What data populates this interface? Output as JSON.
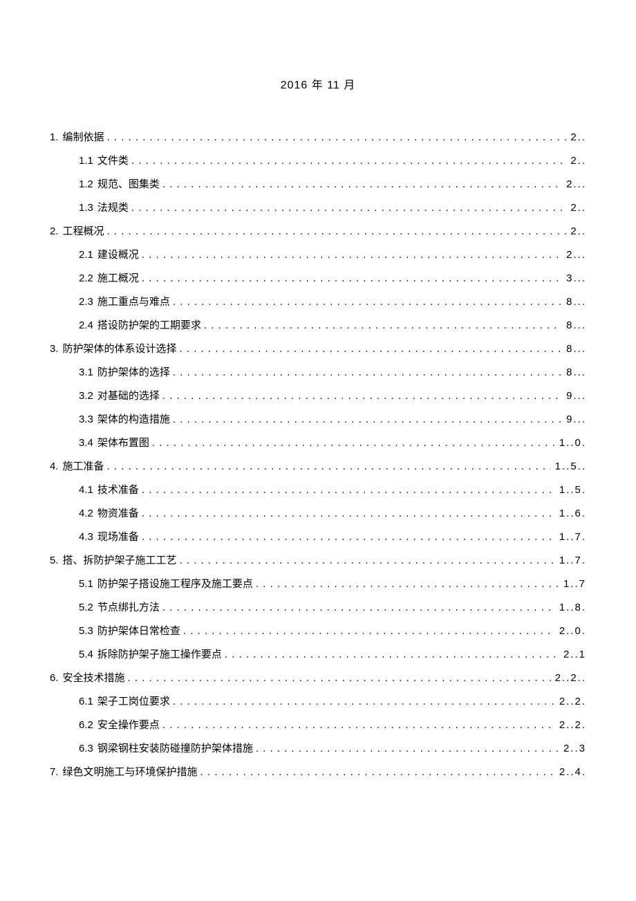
{
  "date": "2016 年 11 月",
  "toc": [
    {
      "level": 1,
      "num": "1.",
      "title": "编制依据",
      "page": "2.."
    },
    {
      "level": 2,
      "num": "1.1",
      "title": "文件类",
      "page": "2.."
    },
    {
      "level": 2,
      "num": "1.2",
      "title": "规范、图集类",
      "page": "2..."
    },
    {
      "level": 2,
      "num": "1.3",
      "title": "法规类",
      "page": "2.."
    },
    {
      "level": 1,
      "num": "2.",
      "title": "工程概况",
      "page": "2.."
    },
    {
      "level": 2,
      "num": "2.1",
      "title": "建设概况",
      "page": "2..."
    },
    {
      "level": 2,
      "num": "2.2",
      "title": "施工概况",
      "page": "3..."
    },
    {
      "level": 2,
      "num": "2.3",
      "title": "施工重点与难点",
      "page": "8..."
    },
    {
      "level": 2,
      "num": "2.4",
      "title": "搭设防护架的工期要求",
      "page": "8..."
    },
    {
      "level": 1,
      "num": "3.",
      "title": "防护架体的体系设计选择",
      "page": "8..."
    },
    {
      "level": 2,
      "num": "3.1",
      "title": "防护架体的选择",
      "page": "8..."
    },
    {
      "level": 2,
      "num": "3.2",
      "title": "对基础的选择",
      "page": "9..."
    },
    {
      "level": 2,
      "num": "3.3",
      "title": "架体的构造措施",
      "page": "9..."
    },
    {
      "level": 2,
      "num": "3.4",
      "title": "架体布置图",
      "page": "1..0."
    },
    {
      "level": 1,
      "num": "4.",
      "title": "施工准备",
      "page": "1..5.."
    },
    {
      "level": 2,
      "num": "4.1",
      "title": "技术准备",
      "page": "1..5."
    },
    {
      "level": 2,
      "num": "4.2",
      "title": "物资准备",
      "page": "1..6."
    },
    {
      "level": 2,
      "num": "4.3",
      "title": "现场准备",
      "page": "1..7."
    },
    {
      "level": 1,
      "num": "5.",
      "title": "搭、拆防护架子施工工艺",
      "page": "1..7."
    },
    {
      "level": 2,
      "num": "5.1",
      "title": "防护架子搭设施工程序及施工要点",
      "page": "1..7"
    },
    {
      "level": 2,
      "num": "5.2",
      "title": "节点绑扎方法",
      "page": "1..8."
    },
    {
      "level": 2,
      "num": "5.3",
      "title": "防护架体日常检查",
      "page": "2..0."
    },
    {
      "level": 2,
      "num": "5.4",
      "title": "拆除防护架子施工操作要点",
      "page": "2..1"
    },
    {
      "level": 1,
      "num": "6.",
      "title": "安全技术措施",
      "page": "2..2.."
    },
    {
      "level": 2,
      "num": "6.1",
      "title": "架子工岗位要求",
      "page": "2..2."
    },
    {
      "level": 2,
      "num": "6.2",
      "title": "安全操作要点",
      "page": "2..2."
    },
    {
      "level": 2,
      "num": "6.3",
      "title": "钢梁钢柱安装防碰撞防护架体措施",
      "page": "2..3"
    },
    {
      "level": 1,
      "num": "7.",
      "title": "绿色文明施工与环境保护措施",
      "page": "2..4."
    }
  ]
}
